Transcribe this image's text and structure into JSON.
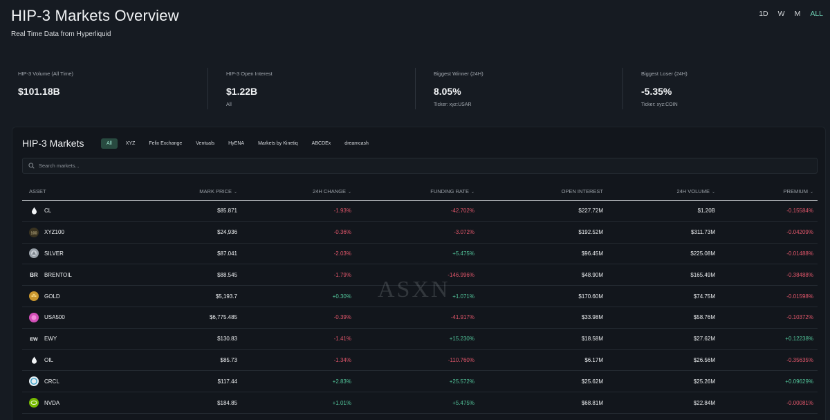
{
  "header": {
    "title": "HIP-3 Markets Overview",
    "subtitle": "Real Time Data from Hyperliquid"
  },
  "ranges": [
    {
      "label": "1D",
      "active": false
    },
    {
      "label": "W",
      "active": false
    },
    {
      "label": "M",
      "active": false
    },
    {
      "label": "ALL",
      "active": true
    }
  ],
  "stats": [
    {
      "label": "HIP-3 Volume (All Time)",
      "value": "$101.18B",
      "sub": ""
    },
    {
      "label": "HIP-3 Open Interest",
      "value": "$1.22B",
      "sub": "All"
    },
    {
      "label": "Biggest Winner (24H)",
      "value": "8.05%",
      "sub": "Ticker: xyz:USAR"
    },
    {
      "label": "Biggest Loser (24H)",
      "value": "-5.35%",
      "sub": "Ticker: xyz:COIN"
    }
  ],
  "markets": {
    "title": "HIP-3 Markets",
    "filters": [
      "All",
      "XYZ",
      "Felix Exchange",
      "Ventuals",
      "HyENA",
      "Markets by Kinetiq",
      "ABCDEx",
      "dreamcash"
    ],
    "active_filter": "All",
    "search_placeholder": "Search markets...",
    "columns": {
      "asset": "ASSET",
      "price": "MARK PRICE",
      "change": "24H CHANGE",
      "funding": "FUNDING RATE",
      "oi": "OPEN INTEREST",
      "volume": "24H VOLUME",
      "premium": "PREMIUM"
    },
    "rows": [
      {
        "icon": "drop-icon",
        "asset": "CL",
        "price": "$85.871",
        "change": "-1.93%",
        "funding": "-42.702%",
        "oi": "$227.72M",
        "volume": "$1.20B",
        "premium": "-0.15584%"
      },
      {
        "icon": "xyz100-icon",
        "icon_text": "100",
        "asset": "XYZ100",
        "price": "$24,936",
        "change": "-0.36%",
        "funding": "-3.072%",
        "oi": "$192.52M",
        "volume": "$311.73M",
        "premium": "-0.04209%"
      },
      {
        "icon": "silver-coin-icon",
        "asset": "SILVER",
        "price": "$87.041",
        "change": "-2.03%",
        "funding": "+5.475%",
        "oi": "$96.45M",
        "volume": "$225.08M",
        "premium": "-0.01488%"
      },
      {
        "icon": "brentoil-icon",
        "icon_text": "BR",
        "asset": "BRENTOIL",
        "price": "$88.545",
        "change": "-1.79%",
        "funding": "-146.996%",
        "oi": "$48.90M",
        "volume": "$165.49M",
        "premium": "-0.38488%"
      },
      {
        "icon": "gold-coin-icon",
        "asset": "GOLD",
        "price": "$5,193.7",
        "change": "+0.30%",
        "funding": "+1.071%",
        "oi": "$170.60M",
        "volume": "$74.75M",
        "premium": "-0.01598%"
      },
      {
        "icon": "usa500-icon",
        "asset": "USA500",
        "price": "$6,775.485",
        "change": "-0.39%",
        "funding": "-41.917%",
        "oi": "$33.98M",
        "volume": "$58.76M",
        "premium": "-0.10372%"
      },
      {
        "icon": "ewy-icon",
        "icon_text": "EW",
        "asset": "EWY",
        "price": "$130.83",
        "change": "-1.41%",
        "funding": "+15.230%",
        "oi": "$18.58M",
        "volume": "$27.62M",
        "premium": "+0.12238%"
      },
      {
        "icon": "drop-icon",
        "asset": "OIL",
        "price": "$85.73",
        "change": "-1.34%",
        "funding": "-110.760%",
        "oi": "$6.17M",
        "volume": "$26.56M",
        "premium": "-0.35635%"
      },
      {
        "icon": "crcl-icon",
        "asset": "CRCL",
        "price": "$117.44",
        "change": "+2.83%",
        "funding": "+25.572%",
        "oi": "$25.62M",
        "volume": "$25.26M",
        "premium": "+0.09629%"
      },
      {
        "icon": "nvda-icon",
        "asset": "NVDA",
        "price": "$184.85",
        "change": "+1.01%",
        "funding": "+5.475%",
        "oi": "$68.81M",
        "volume": "$22.84M",
        "premium": "-0.00081%"
      }
    ]
  },
  "watermark": "ASXN",
  "colors": {
    "background": "#161b22",
    "panel": "#12161c",
    "accent": "#6fd0b4",
    "negative": "#e0566a",
    "positive": "#52c49a"
  }
}
